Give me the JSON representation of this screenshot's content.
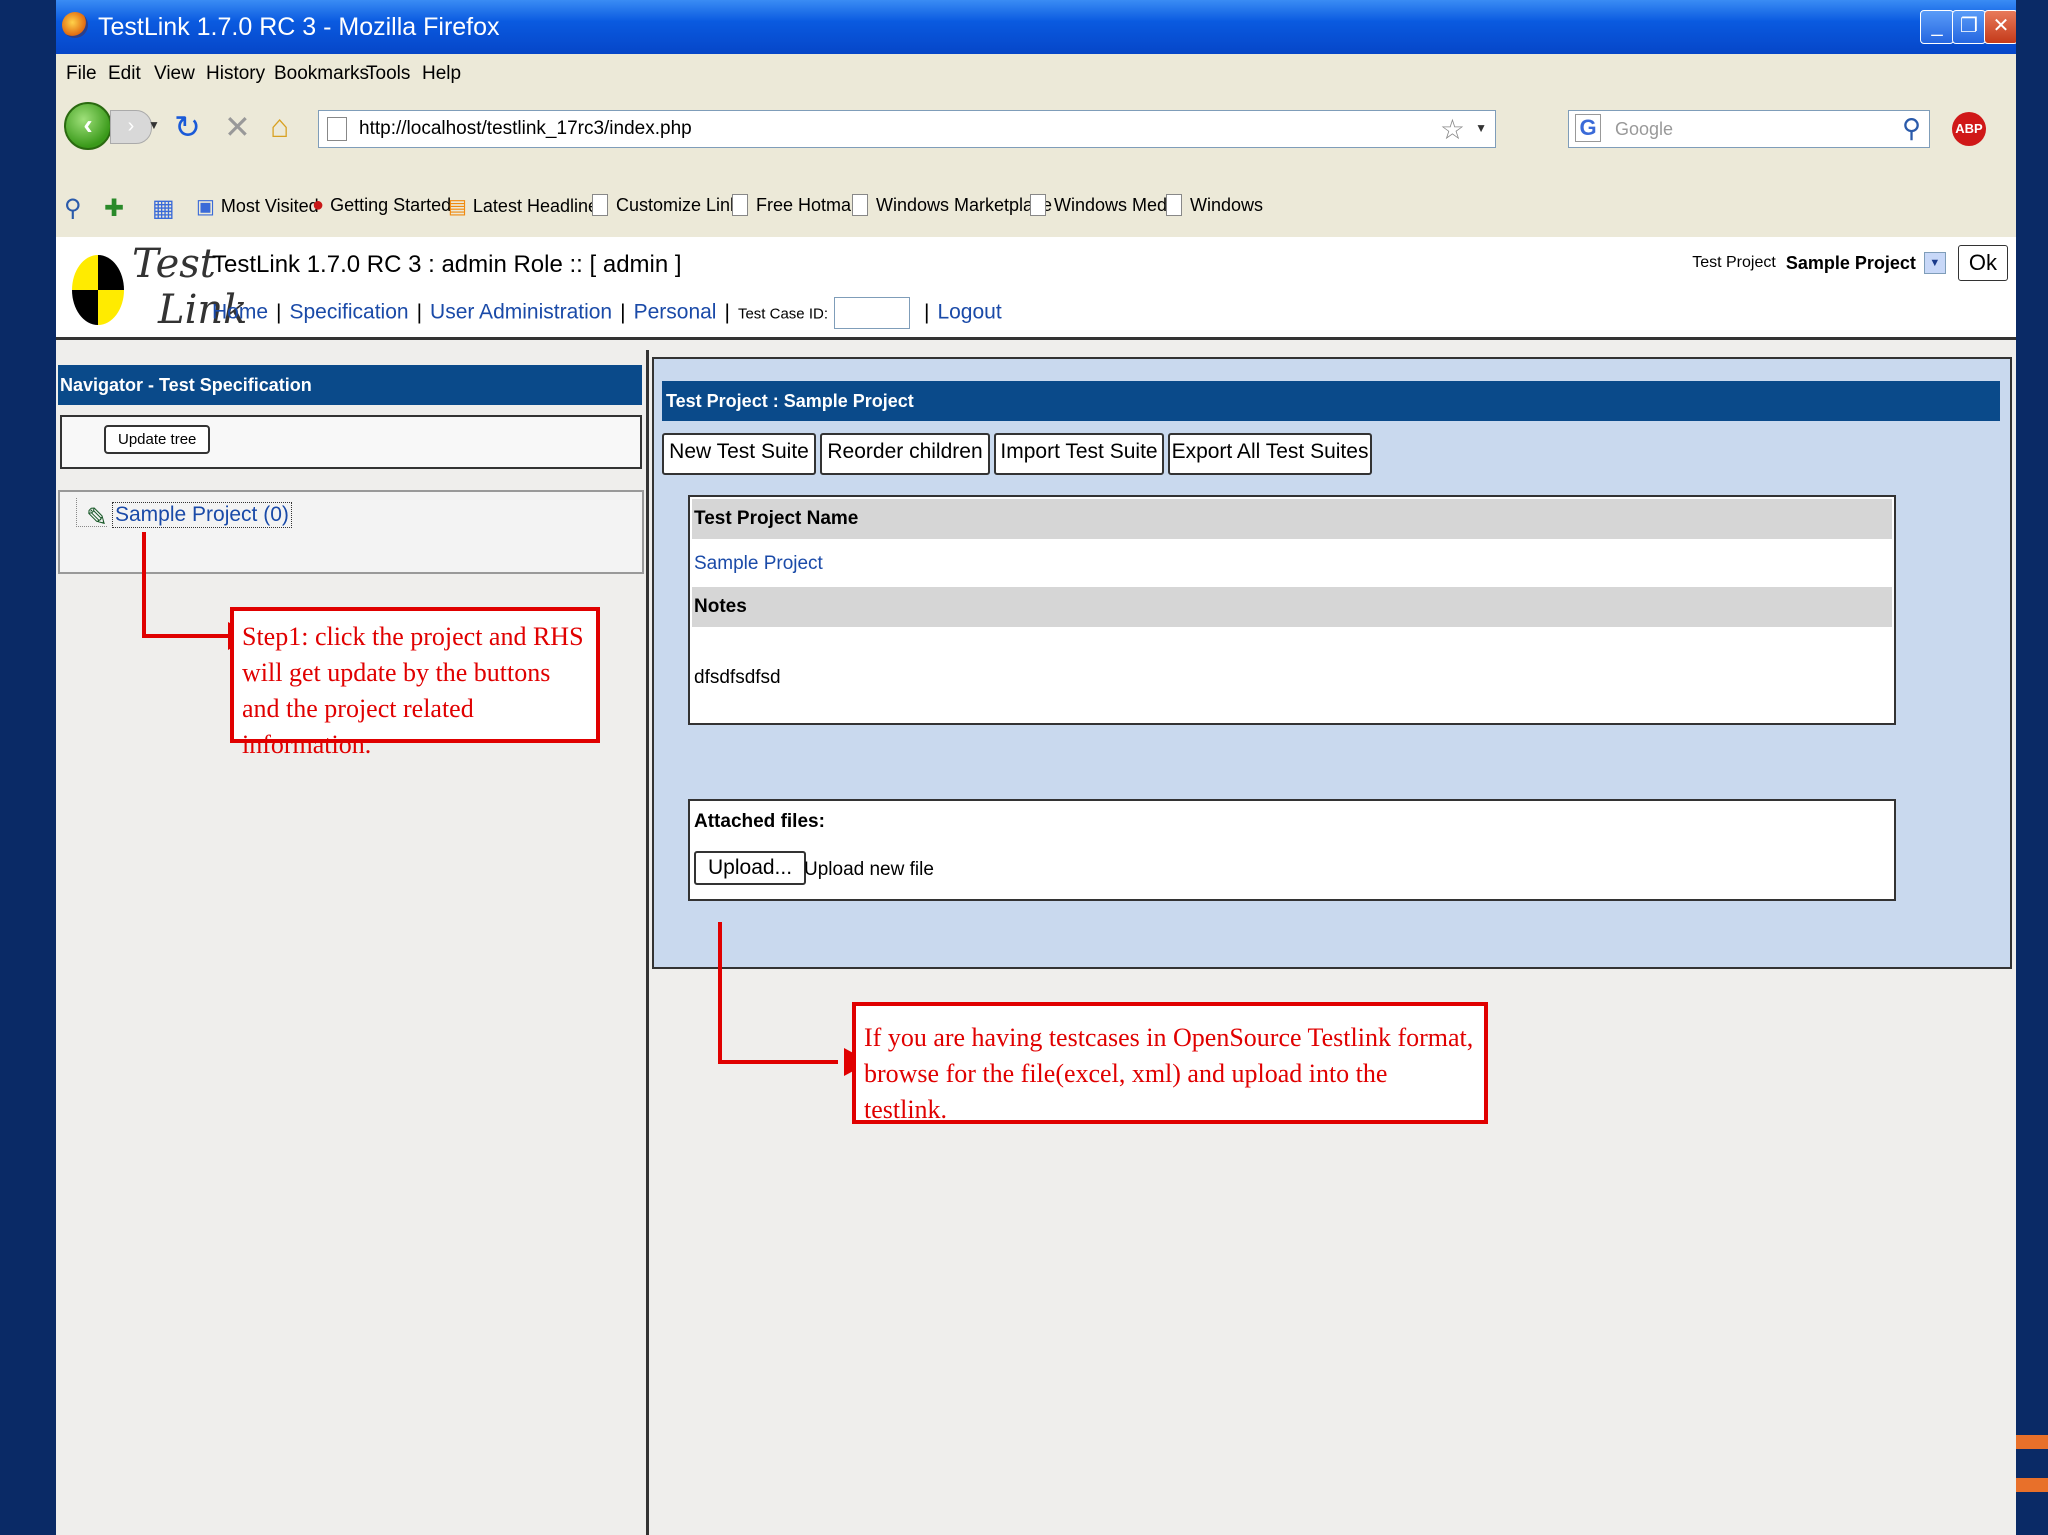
{
  "window": {
    "title": "TestLink 1.7.0 RC 3 - Mozilla Firefox"
  },
  "menu": [
    "File",
    "Edit",
    "View",
    "History",
    "Bookmarks",
    "Tools",
    "Help"
  ],
  "navbar": {
    "url": "http://localhost/testlink_17rc3/index.php",
    "search_placeholder": "Google"
  },
  "bookmarks": [
    "Most Visited",
    "Getting Started",
    "Latest Headlines",
    "Customize Links",
    "Free Hotmail",
    "Windows Marketplace",
    "Windows Media",
    "Windows"
  ],
  "testlink": {
    "logo_test": "Test",
    "logo_link": "Link",
    "title": "TestLink 1.7.0 RC 3 : admin Role :: [ admin ]",
    "links": [
      "Home",
      "Specification",
      "User Administration",
      "Personal"
    ],
    "tcid_label": "Test Case ID:",
    "logout": "Logout",
    "project_label": "Test Project",
    "project_value": "Sample Project",
    "ok_label": "Ok"
  },
  "navigator": {
    "header": "Navigator - Test Specification",
    "update_tree": "Update tree",
    "tree_root": "Sample Project (0)"
  },
  "main": {
    "header": "Test Project : Sample Project",
    "buttons": [
      "New Test Suite",
      "Reorder children",
      "Import Test Suite",
      "Export All Test Suites"
    ],
    "name_header": "Test Project Name",
    "project_name": "Sample Project",
    "notes_header": "Notes",
    "notes_value": "dfsdfsdfsd",
    "attached_label": "Attached files:",
    "upload_label": "Upload...",
    "upload_hint": "Upload new file"
  },
  "annotations": {
    "step1": "Step1: click the project and RHS will get update by the buttons and the project related information.",
    "step2": "If you are having testcases in OpenSource Testlink format, browse for the file(excel, xml) and upload into the testlink."
  },
  "colors": {
    "header_bar": "#0a4a8a",
    "annotation": "#e00000",
    "main_panel_bg": "#c9d9ee"
  }
}
